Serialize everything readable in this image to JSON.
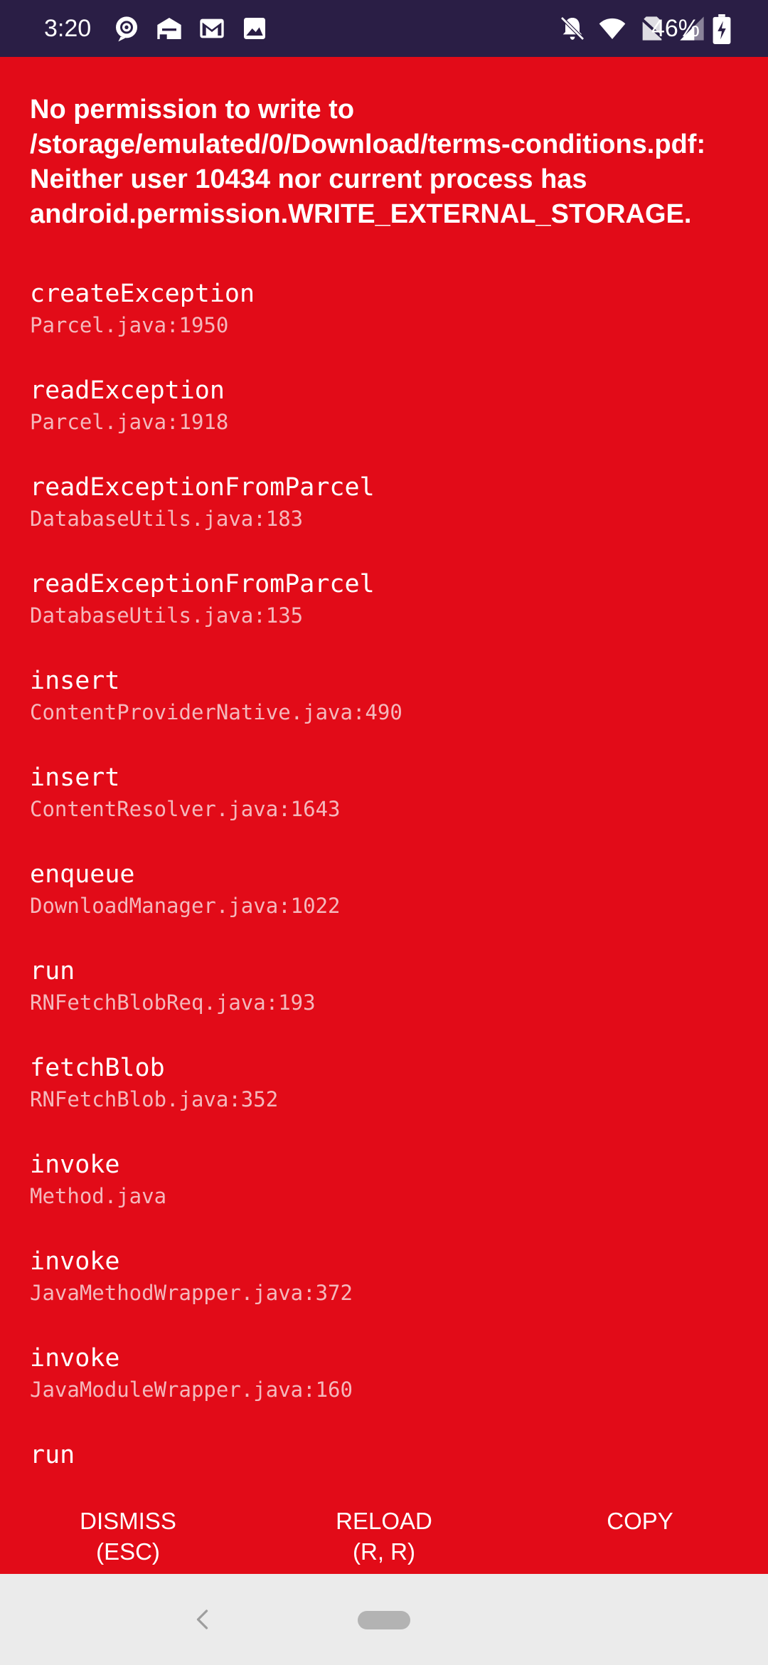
{
  "status_bar": {
    "time": "3:20",
    "battery_percent": "46%",
    "left_icons": [
      "at-sign-notification-icon",
      "inbox-icon",
      "gmail-icon",
      "image-icon"
    ],
    "right_icons": [
      "notifications-off-icon",
      "wifi-icon",
      "no-sim-icon",
      "signal-icon",
      "battery-charging-icon"
    ]
  },
  "error": {
    "message": "No permission to write to /storage/emulated/0/Download/terms-conditions.pdf: Neither user 10434 nor current process has android.permission.WRITE_EXTERNAL_STORAGE.",
    "stack_trace": [
      {
        "method": "createException",
        "file": "Parcel.java:1950"
      },
      {
        "method": "readException",
        "file": "Parcel.java:1918"
      },
      {
        "method": "readExceptionFromParcel",
        "file": "DatabaseUtils.java:183"
      },
      {
        "method": "readExceptionFromParcel",
        "file": "DatabaseUtils.java:135"
      },
      {
        "method": "insert",
        "file": "ContentProviderNative.java:490"
      },
      {
        "method": "insert",
        "file": "ContentResolver.java:1643"
      },
      {
        "method": "enqueue",
        "file": "DownloadManager.java:1022"
      },
      {
        "method": "run",
        "file": "RNFetchBlobReq.java:193"
      },
      {
        "method": "fetchBlob",
        "file": "RNFetchBlob.java:352"
      },
      {
        "method": "invoke",
        "file": "Method.java"
      },
      {
        "method": "invoke",
        "file": "JavaMethodWrapper.java:372"
      },
      {
        "method": "invoke",
        "file": "JavaModuleWrapper.java:160"
      },
      {
        "method": "run",
        "file": ""
      }
    ]
  },
  "buttons": {
    "dismiss": "DISMISS\n(ESC)",
    "reload": "RELOAD\n(R, R)",
    "copy": "COPY"
  },
  "nav_bar": {
    "back_icon": "back-chevron-icon",
    "home_icon": "home-pill-icon"
  },
  "colors": {
    "background": "#e20b18",
    "status_bar": "#2a1e45",
    "nav_bar": "#ebebeb",
    "text": "#ffffff",
    "file_text": "#f4b8bc"
  }
}
